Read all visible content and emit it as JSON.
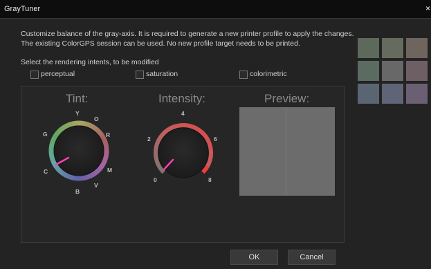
{
  "window": {
    "title": "GrayTuner",
    "close_glyph": "×"
  },
  "description": {
    "line1": "Customize balance of the gray-axis. It is required to generate a new printer profile to apply the changes.",
    "line2": "The existing ColorGPS session can be used. No new profile target needs to be printed."
  },
  "intents": {
    "label": "Select the rendering intents, to be modified",
    "perceptual": "perceptual",
    "saturation": "saturation",
    "colorimetric": "colorimetric"
  },
  "tint": {
    "title": "Tint:",
    "labels": {
      "Y": "Y",
      "O": "O",
      "R": "R",
      "M": "M",
      "V": "V",
      "B": "B",
      "C": "C",
      "G": "G"
    },
    "indicator_color": "#ff3fb4"
  },
  "intensity": {
    "title": "Intensity:",
    "ticks": {
      "t0": "0",
      "t2": "2",
      "t4": "4",
      "t6": "6",
      "t8": "8"
    },
    "value": 0,
    "indicator_color": "#ff3fb4"
  },
  "preview": {
    "title": "Preview:",
    "color": "#6c6c6c"
  },
  "swatches": {
    "colors": [
      "#5d6a5b",
      "#656b5f",
      "#6e655f",
      "#5b6b62",
      "#686868",
      "#6e5f65",
      "#5a6573",
      "#5f6477",
      "#6a5f73"
    ]
  },
  "buttons": {
    "ok": "OK",
    "cancel": "Cancel"
  }
}
